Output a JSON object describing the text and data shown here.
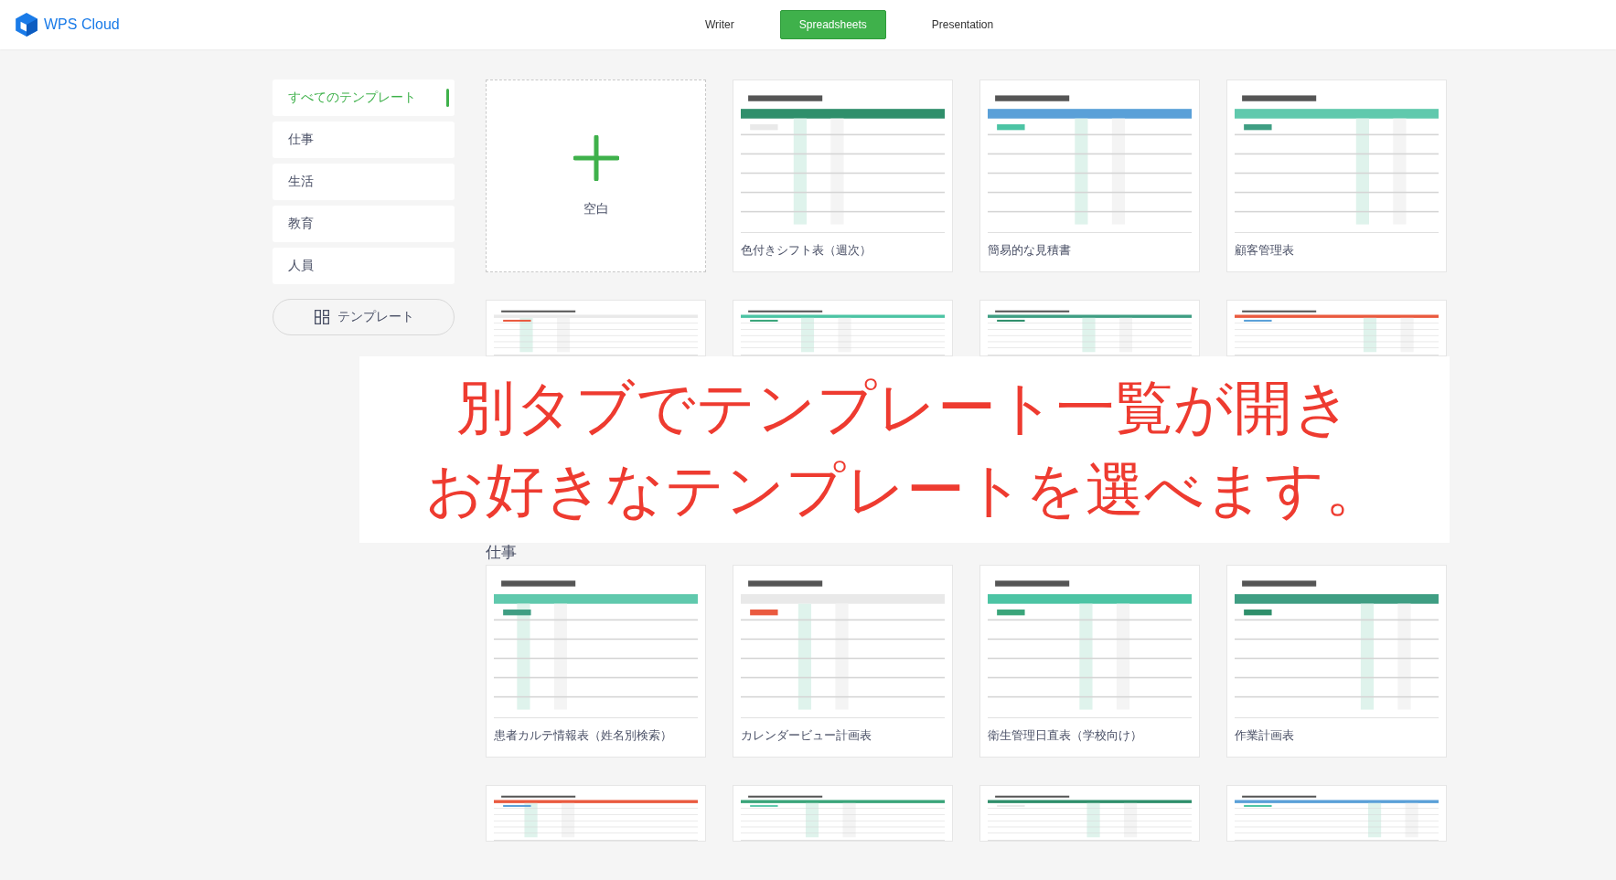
{
  "brand": {
    "name": "WPS Cloud"
  },
  "tabs": [
    {
      "label": "Writer",
      "selected": false
    },
    {
      "label": "Spreadsheets",
      "selected": true
    },
    {
      "label": "Presentation",
      "selected": false
    }
  ],
  "sidebar": {
    "items": [
      {
        "label": "すべてのテンプレート",
        "selected": true
      },
      {
        "label": "仕事",
        "selected": false
      },
      {
        "label": "生活",
        "selected": false
      },
      {
        "label": "教育",
        "selected": false
      },
      {
        "label": "人員",
        "selected": false
      }
    ],
    "template_button": "テンプレート"
  },
  "sections": [
    {
      "cards": [
        {
          "kind": "blank",
          "label": "空白"
        },
        {
          "kind": "template",
          "label": "色付きシフト表（週次）"
        },
        {
          "kind": "template",
          "label": "簡易的な見積書"
        },
        {
          "kind": "template",
          "label": "顧客管理表"
        },
        {
          "kind": "template"
        },
        {
          "kind": "template"
        },
        {
          "kind": "template"
        },
        {
          "kind": "template"
        }
      ]
    },
    {
      "heading": "仕事",
      "cards": [
        {
          "kind": "template",
          "label": "患者カルテ情報表（姓名別検索）"
        },
        {
          "kind": "template",
          "label": "カレンダービュー計画表"
        },
        {
          "kind": "template",
          "label": "衛生管理日直表（学校向け）"
        },
        {
          "kind": "template",
          "label": "作業計画表"
        },
        {
          "kind": "template"
        },
        {
          "kind": "template"
        },
        {
          "kind": "template"
        },
        {
          "kind": "template"
        }
      ]
    }
  ],
  "overlay": {
    "lines": [
      "別タブでテンプレート一覧が開き",
      "お好きなテンプレートを選べます。"
    ]
  }
}
